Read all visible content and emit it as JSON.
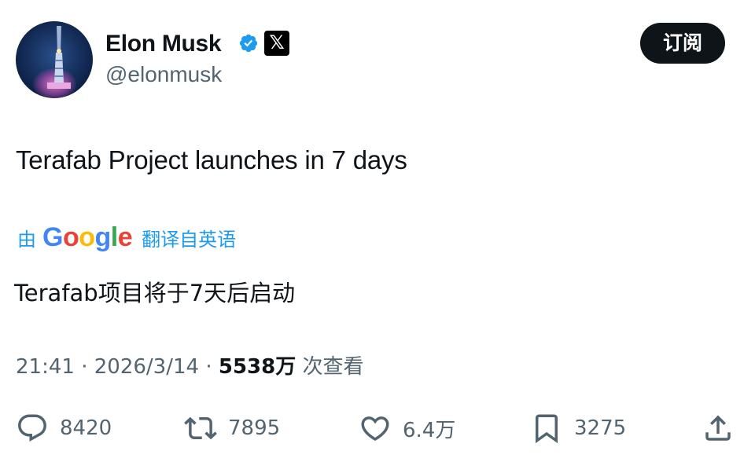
{
  "author": {
    "name": "Elon Musk",
    "handle": "@elonmusk",
    "badge_symbol": "𝕏",
    "verified_color": "#1d9bf0"
  },
  "subscribe_label": "订阅",
  "tweet": {
    "text": "Terafab Project launches in 7 days"
  },
  "translation": {
    "by": "由",
    "google": [
      "G",
      "o",
      "o",
      "g",
      "l",
      "e"
    ],
    "action": "翻译自英语",
    "text": "Terafab项目将于7天后启动"
  },
  "meta": {
    "time": "21:41",
    "sep1": " · ",
    "date": "2026/3/14",
    "sep2": " · ",
    "views": "5538万",
    "views_label": " 次查看"
  },
  "actions": {
    "replies": "8420",
    "reposts": "7895",
    "likes": "6.4万",
    "bookmarks": "3275",
    "icons": [
      "reply-icon",
      "repost-icon",
      "like-icon",
      "bookmark-icon",
      "share-icon"
    ]
  },
  "colors": {
    "text": "#0f1419",
    "secondary": "#536471",
    "accent": "#1d9bf0"
  }
}
